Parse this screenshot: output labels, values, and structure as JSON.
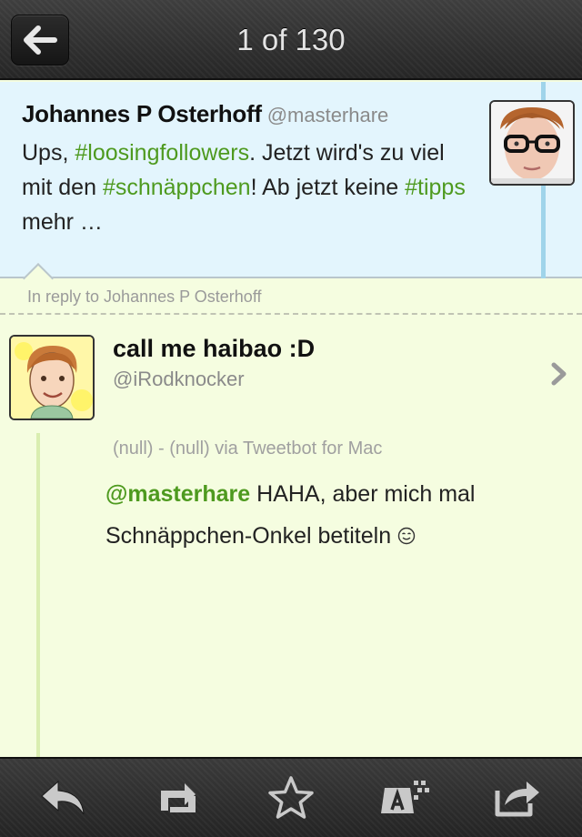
{
  "navbar": {
    "title": "1 of 130",
    "back_icon": "back-arrow-icon"
  },
  "parent_tweet": {
    "name": "Johannes P Osterhoff",
    "handle": "@masterhare",
    "text_parts": {
      "p1": "Ups, ",
      "h1": "#loosingfollowers",
      "p2": ". Jetzt wird's zu viel mit den ",
      "h2": "#schnäppchen",
      "p3": "! Ab jetzt keine ",
      "h3": "#tipps",
      "p4": " mehr …"
    }
  },
  "in_reply_to": "In reply to Johannes P Osterhoff",
  "reply": {
    "name": "call me haibao :D",
    "handle": "@iRodknocker",
    "meta": "(null) - (null) via Tweetbot for Mac",
    "mention": "@masterhare",
    "text": " HAHA, aber mich mal Schnäppchen-Onkel betiteln ",
    "emoji_icon": "smiley-icon"
  },
  "toolbar": {
    "icons": [
      "reply-icon",
      "retweet-icon",
      "favorite-star-icon",
      "translate-icon",
      "share-icon"
    ]
  },
  "colors": {
    "hashtag": "#4e9a1f",
    "parent_bg": "#e3f5fd",
    "reply_bg": "#f5fde0",
    "thread_line_blue": "#9fd4ea",
    "thread_line_green": "#d9eeb0"
  }
}
